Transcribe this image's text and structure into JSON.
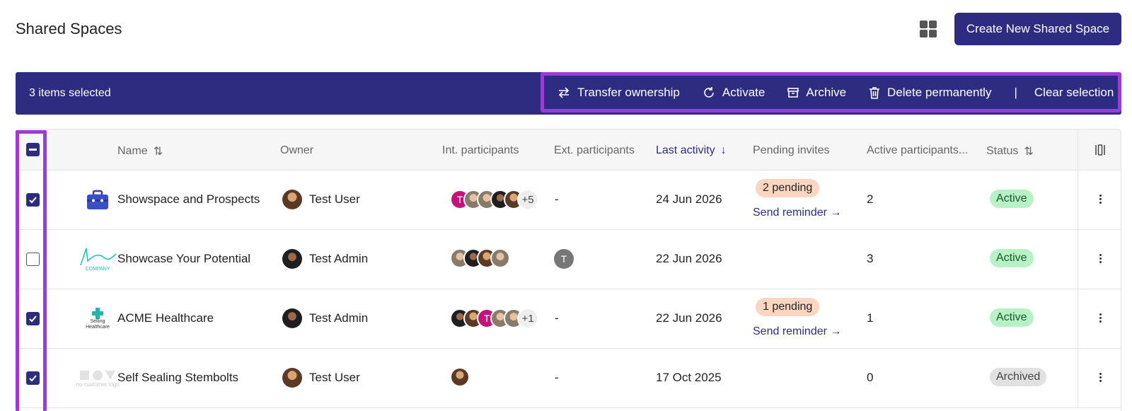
{
  "page": {
    "title": "Shared Spaces"
  },
  "header": {
    "create_label": "Create New Shared Space",
    "view_toggle_icon": "grid-icon"
  },
  "selection": {
    "count_label": "3 items selected",
    "actions": {
      "transfer": "Transfer ownership",
      "activate": "Activate",
      "archive": "Archive",
      "delete": "Delete permanently",
      "separator": "|",
      "clear": "Clear selection"
    }
  },
  "columns": {
    "name": "Name",
    "owner": "Owner",
    "int_participants": "Int. participants",
    "ext_participants": "Ext. participants",
    "last_activity": "Last activity",
    "pending_invites": "Pending invites",
    "active_participants": "Active participants...",
    "status": "Status"
  },
  "rows": [
    {
      "checked": true,
      "name": "Showspace and Prospects",
      "owner": "Test User",
      "int_more": "+5",
      "int_initial": "T",
      "ext": "-",
      "last_activity": "24 Jun 2026",
      "pending": "2 pending",
      "reminder": "Send reminder →",
      "active_participants": "2",
      "status": "Active"
    },
    {
      "checked": false,
      "name": "Showcase Your Potential",
      "owner": "Test Admin",
      "logo_caption": "COMPANY",
      "ext_initial": "T",
      "last_activity": "22 Jun 2026",
      "active_participants": "3",
      "status": "Active"
    },
    {
      "checked": true,
      "name": "ACME Healthcare",
      "owner": "Test Admin",
      "logo_caption": "Selling Healthcare",
      "int_more": "+1",
      "int_initial": "T",
      "ext": "-",
      "last_activity": "22 Jun 2026",
      "pending": "1 pending",
      "reminder": "Send reminder →",
      "active_participants": "1",
      "status": "Active"
    },
    {
      "checked": true,
      "name": "Self Sealing Stembolts",
      "owner": "Test User",
      "logo_caption": "no customer logo",
      "ext": "-",
      "last_activity": "17 Oct 2025",
      "active_participants": "0",
      "status": "Archived"
    }
  ],
  "colors": {
    "brand": "#2d2c80",
    "highlight": "#9b3bd9",
    "active_bg": "#b9f1c7",
    "pending_bg": "#fcd6c0"
  }
}
